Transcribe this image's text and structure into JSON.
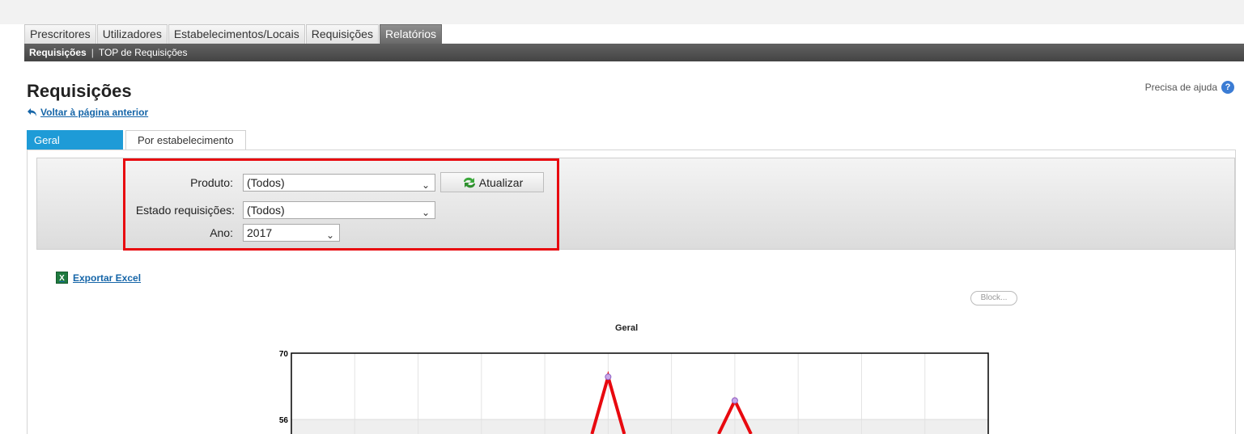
{
  "main_tabs": [
    "Prescritores",
    "Utilizadores",
    "Estabelecimentos/Locais",
    "Requisições",
    "Relatórios"
  ],
  "active_main_tab": "Relatórios",
  "subnav": {
    "current": "Requisições",
    "separator": "|",
    "other": "TOP de Requisições"
  },
  "page": {
    "title": "Requisições",
    "back_link": "Voltar à página anterior",
    "help_text": "Precisa de ajuda",
    "help_icon": "question-circle-icon"
  },
  "content_tabs": [
    "Geral",
    "Por estabelecimento"
  ],
  "filters": {
    "produto_label": "Produto:",
    "produto_value": "(Todos)",
    "estado_label": "Estado requisições:",
    "estado_value": "(Todos)",
    "ano_label": "Ano:",
    "ano_value": "2017",
    "update_button": "Atualizar"
  },
  "export_label": "Exportar Excel",
  "block_button": "Block...",
  "colors": {
    "accent": "#1e9bd7",
    "highlight": "#e8090f",
    "line": "#e8090f",
    "link": "#1565a8"
  },
  "chart_data": {
    "type": "line",
    "title": "Geral",
    "xlabel": "",
    "ylabel": "",
    "yticks": [
      70,
      56
    ],
    "ylim_visible": [
      52,
      70
    ],
    "grid": true,
    "series": [
      {
        "values": [
          65,
          60
        ]
      }
    ],
    "x_index_of_points": [
      5,
      7
    ],
    "x_divisions": 11
  }
}
